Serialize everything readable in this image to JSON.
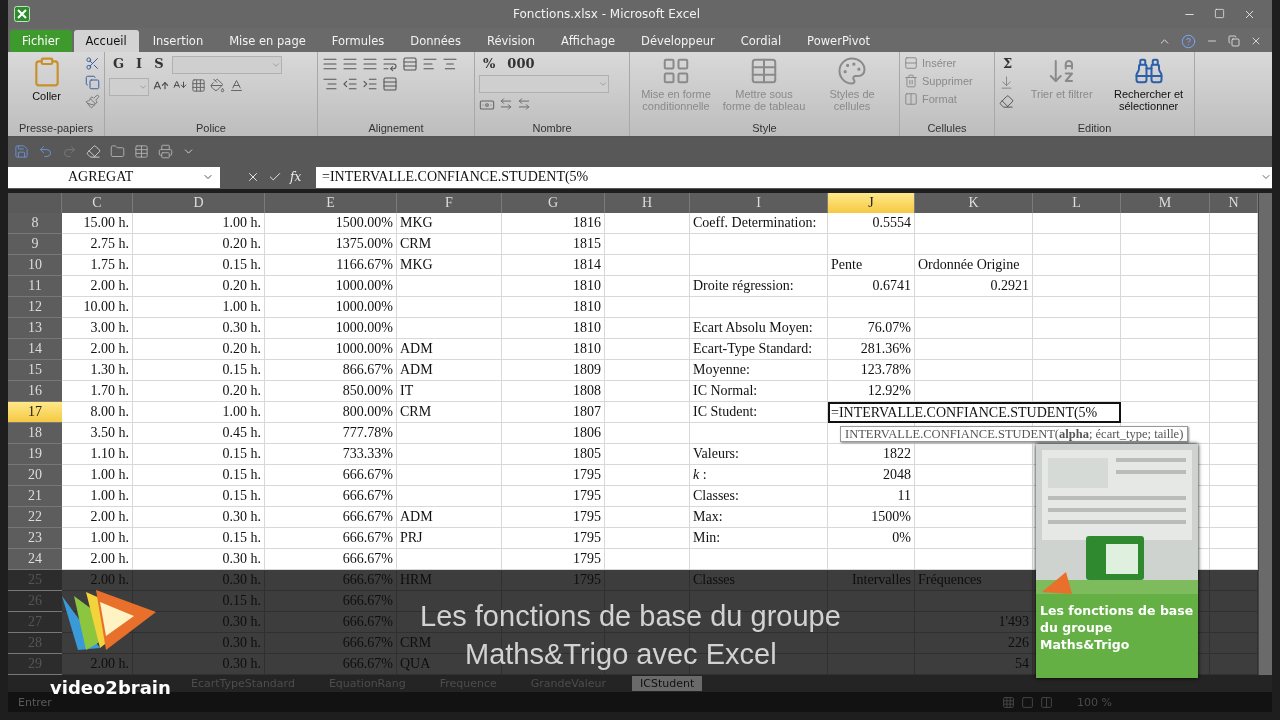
{
  "window": {
    "title": "Fonctions.xlsx - Microsoft Excel"
  },
  "ribbon_tabs": [
    {
      "label": "Fichier",
      "kind": "file",
      "selected": false
    },
    {
      "label": "Accueil",
      "kind": "tab",
      "selected": true
    },
    {
      "label": "Insertion",
      "kind": "tab",
      "selected": false
    },
    {
      "label": "Mise en page",
      "kind": "tab",
      "selected": false
    },
    {
      "label": "Formules",
      "kind": "tab",
      "selected": false
    },
    {
      "label": "Données",
      "kind": "tab",
      "selected": false
    },
    {
      "label": "Révision",
      "kind": "tab",
      "selected": false
    },
    {
      "label": "Affichage",
      "kind": "tab",
      "selected": false
    },
    {
      "label": "Développeur",
      "kind": "tab",
      "selected": false
    },
    {
      "label": "Cordial",
      "kind": "tab",
      "selected": false
    },
    {
      "label": "PowerPivot",
      "kind": "tab",
      "selected": false
    }
  ],
  "ribbon_groups": [
    {
      "name": "Presse-papiers",
      "buttons": [
        {
          "label": "Coller",
          "kind": "large",
          "disabled": false
        }
      ]
    },
    {
      "name": "Police",
      "buttons": [
        {
          "label": "G",
          "kind": "small",
          "disabled": false
        },
        {
          "label": "I",
          "kind": "small",
          "disabled": false
        },
        {
          "label": "S",
          "kind": "small",
          "disabled": false
        }
      ]
    },
    {
      "name": "Alignement"
    },
    {
      "name": "Nombre",
      "buttons": [
        {
          "label": "%",
          "kind": "small",
          "disabled": false
        },
        {
          "label": "000",
          "kind": "small",
          "disabled": false
        }
      ]
    },
    {
      "name": "Style",
      "buttons": [
        {
          "label": "Mise en forme conditionnelle",
          "kind": "large",
          "disabled": true
        },
        {
          "label": "Mettre sous forme de tableau",
          "kind": "large",
          "disabled": true
        },
        {
          "label": "Styles de cellules",
          "kind": "large",
          "disabled": true
        }
      ]
    },
    {
      "name": "Cellules",
      "buttons": [
        {
          "label": "Insérer",
          "kind": "row",
          "disabled": true
        },
        {
          "label": "Supprimer",
          "kind": "row",
          "disabled": true
        },
        {
          "label": "Format",
          "kind": "row",
          "disabled": true
        }
      ]
    },
    {
      "name": "Edition",
      "buttons": [
        {
          "label": "Σ",
          "kind": "small",
          "disabled": false
        },
        {
          "label": "Trier et filtrer",
          "kind": "large",
          "disabled": true
        },
        {
          "label": "Rechercher et sélectionner",
          "kind": "large",
          "disabled": false
        }
      ]
    }
  ],
  "formula_bar": {
    "name_box": "AGREGAT",
    "function_label": "fx",
    "formula": "=INTERVALLE.CONFIANCE.STUDENT(5%"
  },
  "columns": [
    {
      "label": "C",
      "selected": false
    },
    {
      "label": "D",
      "selected": false
    },
    {
      "label": "E",
      "selected": false
    },
    {
      "label": "F",
      "selected": false
    },
    {
      "label": "G",
      "selected": false
    },
    {
      "label": "H",
      "selected": false
    },
    {
      "label": "I",
      "selected": false
    },
    {
      "label": "J",
      "selected": true
    },
    {
      "label": "K",
      "selected": false
    },
    {
      "label": "L",
      "selected": false
    },
    {
      "label": "M",
      "selected": false
    },
    {
      "label": "N",
      "selected": false
    }
  ],
  "rows": [
    {
      "number": "8",
      "selected": false,
      "dimmed": false,
      "cells": [
        "15.00 h.",
        "1.00 h.",
        "1500.00%",
        "MKG",
        "1816",
        null,
        "Coeff. Determination:",
        "0.5554",
        null,
        null,
        null,
        null
      ]
    },
    {
      "number": "9",
      "selected": false,
      "dimmed": false,
      "cells": [
        "2.75 h.",
        "0.20 h.",
        "1375.00%",
        "CRM",
        "1815",
        null,
        null,
        null,
        null,
        null,
        null,
        null
      ]
    },
    {
      "number": "10",
      "selected": false,
      "dimmed": false,
      "cells": [
        "1.75 h.",
        "0.15 h.",
        "1166.67%",
        "MKG",
        "1814",
        null,
        null,
        {
          "text": "Pente",
          "kind": "label"
        },
        {
          "text": "Ordonnée Origine",
          "kind": "label"
        },
        null,
        null,
        null
      ]
    },
    {
      "number": "11",
      "selected": false,
      "dimmed": false,
      "cells": [
        "2.00 h.",
        "0.20 h.",
        "1000.00%",
        null,
        "1810",
        null,
        "Droite régression:",
        "0.6741",
        "0.2921",
        null,
        null,
        null
      ]
    },
    {
      "number": "12",
      "selected": false,
      "dimmed": false,
      "cells": [
        "10.00 h.",
        "1.00 h.",
        "1000.00%",
        null,
        "1810",
        null,
        null,
        null,
        null,
        null,
        null,
        null
      ]
    },
    {
      "number": "13",
      "selected": false,
      "dimmed": false,
      "cells": [
        "3.00 h.",
        "0.30 h.",
        "1000.00%",
        null,
        "1810",
        null,
        "Ecart Absolu Moyen:",
        "76.07%",
        null,
        null,
        null,
        null
      ]
    },
    {
      "number": "14",
      "selected": false,
      "dimmed": false,
      "cells": [
        "2.00 h.",
        "0.20 h.",
        "1000.00%",
        "ADM",
        "1810",
        null,
        "Ecart-Type Standard:",
        "281.36%",
        null,
        null,
        null,
        null
      ]
    },
    {
      "number": "15",
      "selected": false,
      "dimmed": false,
      "cells": [
        "1.30 h.",
        "0.15 h.",
        "866.67%",
        "ADM",
        "1809",
        null,
        "Moyenne:",
        "123.78%",
        null,
        null,
        null,
        null
      ]
    },
    {
      "number": "16",
      "selected": false,
      "dimmed": false,
      "cells": [
        "1.70 h.",
        "0.20 h.",
        "850.00%",
        "IT",
        "1808",
        null,
        "IC Normal:",
        "12.92%",
        null,
        null,
        null,
        null
      ]
    },
    {
      "number": "17",
      "selected": true,
      "dimmed": false,
      "cells": [
        "8.00 h.",
        "1.00 h.",
        "800.00%",
        "CRM",
        "1807",
        null,
        "IC Student:",
        {
          "text": "=INTERVALLE.CONFIANCE.STUDENT(5%",
          "active": true
        },
        null,
        null,
        null,
        null
      ]
    },
    {
      "number": "18",
      "selected": false,
      "dimmed": false,
      "cells": [
        "3.50 h.",
        "0.45 h.",
        "777.78%",
        null,
        "1806",
        null,
        null,
        null,
        null,
        null,
        null,
        null
      ]
    },
    {
      "number": "19",
      "selected": false,
      "dimmed": false,
      "cells": [
        "1.10 h.",
        "0.15 h.",
        "733.33%",
        null,
        "1805",
        null,
        "Valeurs:",
        "1822",
        null,
        null,
        null,
        null
      ]
    },
    {
      "number": "20",
      "selected": false,
      "dimmed": false,
      "cells": [
        "1.00 h.",
        "0.15 h.",
        "666.67%",
        null,
        "1795",
        null,
        "*k* :",
        "2048",
        null,
        null,
        null,
        null
      ]
    },
    {
      "number": "21",
      "selected": false,
      "dimmed": false,
      "cells": [
        "1.00 h.",
        "0.15 h.",
        "666.67%",
        null,
        "1795",
        null,
        "Classes:",
        "11",
        null,
        null,
        null,
        null
      ]
    },
    {
      "number": "22",
      "selected": false,
      "dimmed": false,
      "cells": [
        "2.00 h.",
        "0.30 h.",
        "666.67%",
        "ADM",
        "1795",
        null,
        "Max:",
        "1500%",
        null,
        null,
        null,
        null
      ]
    },
    {
      "number": "23",
      "selected": false,
      "dimmed": false,
      "cells": [
        "1.00 h.",
        "0.15 h.",
        "666.67%",
        "PRJ",
        "1795",
        null,
        "Min:",
        "0%",
        null,
        null,
        null,
        null
      ]
    },
    {
      "number": "24",
      "selected": false,
      "dimmed": false,
      "cells": [
        "2.00 h.",
        "0.30 h.",
        "666.67%",
        null,
        "1795",
        null,
        null,
        null,
        null,
        null,
        null,
        null
      ]
    },
    {
      "number": "25",
      "selected": false,
      "dimmed": true,
      "cells": [
        "2.00 h.",
        "0.30 h.",
        "666.67%",
        "HRM",
        "1795",
        null,
        "Classes",
        "Intervalles",
        {
          "text": "Fréquences",
          "kind": "label"
        },
        null,
        null,
        null
      ]
    },
    {
      "number": "26",
      "selected": false,
      "dimmed": true,
      "cells": [
        null,
        "0.15 h.",
        "666.67%",
        null,
        null,
        null,
        null,
        null,
        null,
        null,
        null,
        null
      ]
    },
    {
      "number": "27",
      "selected": false,
      "dimmed": true,
      "cells": [
        null,
        "0.30 h.",
        "666.67%",
        null,
        null,
        null,
        null,
        null,
        "1'493",
        null,
        null,
        null
      ]
    },
    {
      "number": "28",
      "selected": false,
      "dimmed": true,
      "cells": [
        null,
        "0.30 h.",
        "666.67%",
        "CRM",
        null,
        null,
        null,
        null,
        "226",
        null,
        null,
        null
      ]
    },
    {
      "number": "29",
      "selected": false,
      "dimmed": true,
      "cells": [
        "2.00 h.",
        "0.30 h.",
        "666.67%",
        "QUA",
        null,
        null,
        null,
        null,
        "54",
        null,
        null,
        null
      ]
    }
  ],
  "tooltip": "INTERVALLE.CONFIANCE.STUDENT(**alpha**; écart_type; taille)",
  "sheet_tabs": [
    {
      "label": "EcartTypeStandard",
      "selected": false
    },
    {
      "label": "EquationRang",
      "selected": false
    },
    {
      "label": "Frequence",
      "selected": false
    },
    {
      "label": "GrandeValeur",
      "selected": false
    },
    {
      "label": "ICStudent",
      "selected": true
    }
  ],
  "status_bar": {
    "mode": "Entrer",
    "zoom": "100 %"
  },
  "video_overlay": {
    "brand": "video2brain",
    "caption": [
      "Les fonctions de base du groupe",
      "Maths&Trigo avec Excel"
    ],
    "product_title": "Les fonctions de base du groupe Maths&Trigo"
  }
}
